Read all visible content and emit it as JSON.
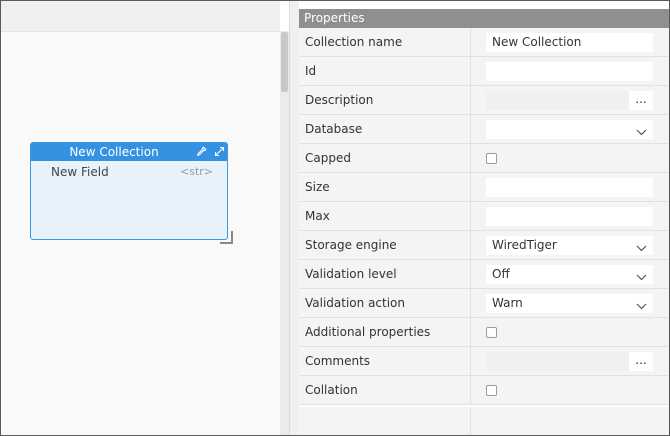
{
  "entity": {
    "title": "New Collection",
    "fields": [
      {
        "name": "New Field",
        "type": "<str>"
      }
    ]
  },
  "properties": {
    "header": "Properties",
    "rows": [
      {
        "label": "Collection name",
        "kind": "input",
        "value": "New Collection"
      },
      {
        "label": "Id",
        "kind": "input",
        "value": ""
      },
      {
        "label": "Description",
        "kind": "text-dots",
        "value": "",
        "dots": "..."
      },
      {
        "label": "Database",
        "kind": "select",
        "value": ""
      },
      {
        "label": "Capped",
        "kind": "checkbox",
        "checked": false
      },
      {
        "label": "Size",
        "kind": "input",
        "value": ""
      },
      {
        "label": "Max",
        "kind": "input",
        "value": ""
      },
      {
        "label": "Storage engine",
        "kind": "select",
        "value": "WiredTiger"
      },
      {
        "label": "Validation level",
        "kind": "select",
        "value": "Off"
      },
      {
        "label": "Validation action",
        "kind": "select",
        "value": "Warn"
      },
      {
        "label": "Additional properties",
        "kind": "checkbox",
        "checked": false
      },
      {
        "label": "Comments",
        "kind": "text-dots",
        "value": "",
        "dots": "..."
      },
      {
        "label": "Collation",
        "kind": "checkbox",
        "checked": false
      }
    ]
  },
  "colors": {
    "accent": "#3592e3",
    "entity_bg": "#e8f2fb",
    "panel_header": "#8f8f8f"
  },
  "icons": {
    "pick": "eyedropper-icon",
    "expand": "expand-icon",
    "dropdown": "chevron-down-icon"
  }
}
